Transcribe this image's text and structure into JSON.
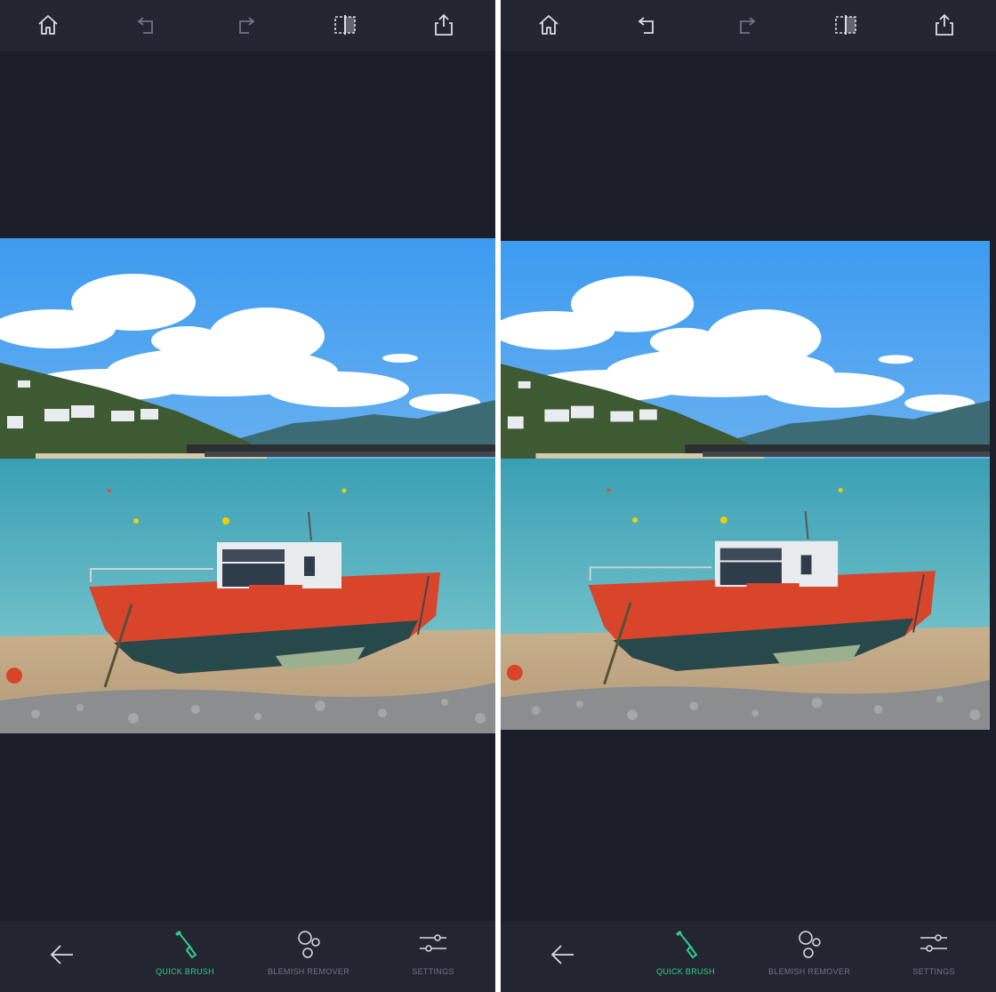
{
  "colors": {
    "background": "#1c1f29",
    "bar": "#232630",
    "icon": "#d9dce3",
    "icon_disabled": "#6f7482",
    "accent": "#2fcc8b",
    "label": "#6f7482"
  },
  "panels": [
    {
      "top_icons": [
        "home-icon",
        "undo-icon",
        "redo-icon",
        "compare-icon",
        "share-icon"
      ],
      "undo_enabled": false,
      "tools": {
        "back_icon": "arrow-left-icon",
        "quick_brush": "QUICK BRUSH",
        "blemish_remover": "BLEMISH REMOVER",
        "settings": "SETTINGS"
      }
    },
    {
      "top_icons": [
        "home-icon",
        "undo-icon",
        "redo-icon",
        "compare-icon",
        "share-icon"
      ],
      "undo_enabled": true,
      "tools": {
        "back_icon": "arrow-left-icon",
        "quick_brush": "QUICK BRUSH",
        "blemish_remover": "BLEMISH REMOVER",
        "settings": "SETTINGS"
      }
    }
  ],
  "photo": {
    "subject": "red-boat-on-beach"
  }
}
